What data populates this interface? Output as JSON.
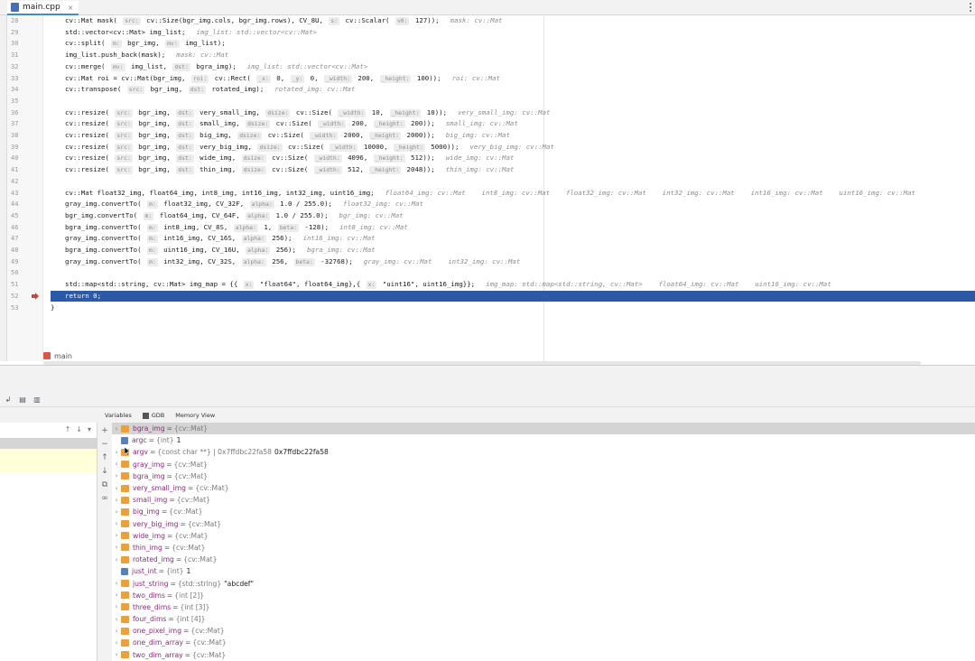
{
  "tab": {
    "file": "main.cpp",
    "close": "×"
  },
  "editor": {
    "lines": [
      {
        "n": "28",
        "parts": [
          [
            "t",
            "cv::Mat mask( "
          ],
          [
            "h",
            "src:"
          ],
          [
            "t",
            " cv::Size(bgr_img.cols, bgr_img.rows), CV_8U, "
          ],
          [
            "h",
            "s:"
          ],
          [
            "t",
            " cv::Scalar( "
          ],
          [
            "h",
            "v0:"
          ],
          [
            "t",
            " 127));"
          ],
          [
            "i",
            "mask: cv::Mat"
          ]
        ]
      },
      {
        "n": "29",
        "parts": [
          [
            "t",
            "std::vector<cv::Mat> img_list;"
          ],
          [
            "i",
            "img_list: std::vector<cv::Mat>"
          ]
        ]
      },
      {
        "n": "30",
        "parts": [
          [
            "t",
            "cv::split( "
          ],
          [
            "h",
            "m:"
          ],
          [
            "t",
            " bgr_img, "
          ],
          [
            "h",
            "mv:"
          ],
          [
            "t",
            " img_list);"
          ]
        ]
      },
      {
        "n": "31",
        "parts": [
          [
            "t",
            "img_list.push_back(mask);"
          ],
          [
            "i",
            "mask: cv::Mat"
          ]
        ]
      },
      {
        "n": "32",
        "parts": [
          [
            "t",
            "cv::merge( "
          ],
          [
            "h",
            "mv:"
          ],
          [
            "t",
            " img_list, "
          ],
          [
            "h",
            "dst:"
          ],
          [
            "t",
            " bgra_img);"
          ],
          [
            "i",
            "img_list: std::vector<cv::Mat>"
          ]
        ]
      },
      {
        "n": "33",
        "parts": [
          [
            "t",
            "cv::Mat roi = cv::Mat(bgr_img, "
          ],
          [
            "h",
            "roi:"
          ],
          [
            "t",
            " cv::Rect( "
          ],
          [
            "h",
            "_x:"
          ],
          [
            "t",
            " 0, "
          ],
          [
            "h",
            "_y:"
          ],
          [
            "t",
            " 0, "
          ],
          [
            "h",
            "_width:"
          ],
          [
            "t",
            " 200, "
          ],
          [
            "h",
            "_height:"
          ],
          [
            "t",
            " 100));"
          ],
          [
            "i",
            "roi: cv::Mat"
          ]
        ]
      },
      {
        "n": "34",
        "parts": [
          [
            "t",
            "cv::transpose( "
          ],
          [
            "h",
            "src:"
          ],
          [
            "t",
            " bgr_img, "
          ],
          [
            "h",
            "dst:"
          ],
          [
            "t",
            " rotated_img);"
          ],
          [
            "i",
            "rotated_img: cv::Mat"
          ]
        ]
      },
      {
        "n": "35",
        "parts": []
      },
      {
        "n": "36",
        "parts": [
          [
            "t",
            "cv::resize( "
          ],
          [
            "h",
            "src:"
          ],
          [
            "t",
            " bgr_img, "
          ],
          [
            "h",
            "dst:"
          ],
          [
            "t",
            " very_small_img, "
          ],
          [
            "h",
            "dsize:"
          ],
          [
            "t",
            " cv::Size( "
          ],
          [
            "h",
            "_width:"
          ],
          [
            "t",
            " 10, "
          ],
          [
            "h",
            "_height:"
          ],
          [
            "t",
            " 10));"
          ],
          [
            "i",
            "very_small_img: cv::Mat"
          ]
        ]
      },
      {
        "n": "37",
        "parts": [
          [
            "t",
            "cv::resize( "
          ],
          [
            "h",
            "src:"
          ],
          [
            "t",
            " bgr_img, "
          ],
          [
            "h",
            "dst:"
          ],
          [
            "t",
            " small_img, "
          ],
          [
            "h",
            "dsize:"
          ],
          [
            "t",
            " cv::Size( "
          ],
          [
            "h",
            "_width:"
          ],
          [
            "t",
            " 200, "
          ],
          [
            "h",
            "_height:"
          ],
          [
            "t",
            " 200));"
          ],
          [
            "i",
            "small_img: cv::Mat"
          ]
        ]
      },
      {
        "n": "38",
        "parts": [
          [
            "t",
            "cv::resize( "
          ],
          [
            "h",
            "src:"
          ],
          [
            "t",
            " bgr_img, "
          ],
          [
            "h",
            "dst:"
          ],
          [
            "t",
            " big_img, "
          ],
          [
            "h",
            "dsize:"
          ],
          [
            "t",
            " cv::Size( "
          ],
          [
            "h",
            "_width:"
          ],
          [
            "t",
            " 2000, "
          ],
          [
            "h",
            "_height:"
          ],
          [
            "t",
            " 2000));"
          ],
          [
            "i",
            "big_img: cv::Mat"
          ]
        ]
      },
      {
        "n": "39",
        "parts": [
          [
            "t",
            "cv::resize( "
          ],
          [
            "h",
            "src:"
          ],
          [
            "t",
            " bgr_img, "
          ],
          [
            "h",
            "dst:"
          ],
          [
            "t",
            " very_big_img, "
          ],
          [
            "h",
            "dsize:"
          ],
          [
            "t",
            " cv::Size( "
          ],
          [
            "h",
            "_width:"
          ],
          [
            "t",
            " 10000, "
          ],
          [
            "h",
            "_height:"
          ],
          [
            "t",
            " 5000));"
          ],
          [
            "i",
            "very_big_img: cv::Mat"
          ]
        ]
      },
      {
        "n": "40",
        "parts": [
          [
            "t",
            "cv::resize( "
          ],
          [
            "h",
            "src:"
          ],
          [
            "t",
            " bgr_img, "
          ],
          [
            "h",
            "dst:"
          ],
          [
            "t",
            " wide_img, "
          ],
          [
            "h",
            "dsize:"
          ],
          [
            "t",
            " cv::Size( "
          ],
          [
            "h",
            "_width:"
          ],
          [
            "t",
            " 4096, "
          ],
          [
            "h",
            "_height:"
          ],
          [
            "t",
            " 512));"
          ],
          [
            "i",
            "wide_img: cv::Mat"
          ]
        ]
      },
      {
        "n": "41",
        "parts": [
          [
            "t",
            "cv::resize( "
          ],
          [
            "h",
            "src:"
          ],
          [
            "t",
            " bgr_img, "
          ],
          [
            "h",
            "dst:"
          ],
          [
            "t",
            " thin_img, "
          ],
          [
            "h",
            "dsize:"
          ],
          [
            "t",
            " cv::Size( "
          ],
          [
            "h",
            "_width:"
          ],
          [
            "t",
            " 512, "
          ],
          [
            "h",
            "_height:"
          ],
          [
            "t",
            " 2048));"
          ],
          [
            "i",
            "thin_img: cv::Mat"
          ]
        ]
      },
      {
        "n": "42",
        "parts": []
      },
      {
        "n": "43",
        "parts": [
          [
            "t",
            "cv::Mat float32_img, float64_img, int8_img, int16_img, int32_img, uint16_img;"
          ],
          [
            "i",
            "float64_img: cv::Mat    int8_img: cv::Mat    float32_img: cv::Mat    int32_img: cv::Mat    int16_img: cv::Mat    uint16_img: cv::Mat"
          ]
        ]
      },
      {
        "n": "44",
        "parts": [
          [
            "t",
            "gray_img.convertTo( "
          ],
          [
            "h",
            "m:"
          ],
          [
            "t",
            " float32_img, CV_32F, "
          ],
          [
            "h",
            "alpha:"
          ],
          [
            "t",
            " 1.0 / 255.0);"
          ],
          [
            "i",
            "float32_img: cv::Mat"
          ]
        ]
      },
      {
        "n": "45",
        "parts": [
          [
            "t",
            "bgr_img.convertTo( "
          ],
          [
            "h",
            "m:"
          ],
          [
            "t",
            " float64_img, CV_64F, "
          ],
          [
            "h",
            "alpha:"
          ],
          [
            "t",
            " 1.0 / 255.0);"
          ],
          [
            "i",
            "bgr_img: cv::Mat"
          ]
        ]
      },
      {
        "n": "46",
        "parts": [
          [
            "t",
            "bgra_img.convertTo( "
          ],
          [
            "h",
            "m:"
          ],
          [
            "t",
            " int8_img, CV_8S, "
          ],
          [
            "h",
            "alpha:"
          ],
          [
            "t",
            " 1, "
          ],
          [
            "h",
            "beta:"
          ],
          [
            "t",
            " -128);"
          ],
          [
            "i",
            "int8_img: cv::Mat"
          ]
        ]
      },
      {
        "n": "47",
        "parts": [
          [
            "t",
            "gray_img.convertTo( "
          ],
          [
            "h",
            "m:"
          ],
          [
            "t",
            " int16_img, CV_16S, "
          ],
          [
            "h",
            "alpha:"
          ],
          [
            "t",
            " 256);"
          ],
          [
            "i",
            "int16_img: cv::Mat"
          ]
        ]
      },
      {
        "n": "48",
        "parts": [
          [
            "t",
            "bgra_img.convertTo( "
          ],
          [
            "h",
            "m:"
          ],
          [
            "t",
            " uint16_img, CV_16U, "
          ],
          [
            "h",
            "alpha:"
          ],
          [
            "t",
            " 256);"
          ],
          [
            "i",
            "bgra_img: cv::Mat"
          ]
        ]
      },
      {
        "n": "49",
        "parts": [
          [
            "t",
            "gray_img.convertTo( "
          ],
          [
            "h",
            "m:"
          ],
          [
            "t",
            " int32_img, CV_32S, "
          ],
          [
            "h",
            "alpha:"
          ],
          [
            "t",
            " 256, "
          ],
          [
            "h",
            "beta:"
          ],
          [
            "t",
            " -32768);"
          ],
          [
            "i",
            "gray_img: cv::Mat    int32_img: cv::Mat"
          ]
        ]
      },
      {
        "n": "50",
        "parts": []
      },
      {
        "n": "51",
        "parts": [
          [
            "t",
            "std::map<std::string, cv::Mat> img_map = {{ "
          ],
          [
            "h",
            "x:"
          ],
          [
            "t",
            " \"float64\", float64_img},{ "
          ],
          [
            "h",
            "x:"
          ],
          [
            "t",
            " \"uint16\", uint16_img}};"
          ],
          [
            "i",
            "img_map: std::map<std::string, cv::Mat>    float64_img: cv::Mat    uint16_img: cv::Mat"
          ]
        ]
      },
      {
        "n": "52",
        "parts": [
          [
            "t",
            "return 0;"
          ]
        ],
        "exec": true
      },
      {
        "n": "53",
        "parts": [
          [
            "t",
            "}"
          ]
        ],
        "brace": true
      }
    ]
  },
  "breadcrumb": {
    "label": "main"
  },
  "debug": {
    "tabs": [
      "Variables",
      "GDB",
      "Memory View"
    ],
    "frame_tools": [
      "↑",
      "↓",
      "▾"
    ],
    "side_buttons": [
      "+",
      "−",
      "↑",
      "↓",
      "⧉",
      "∞"
    ],
    "variables": [
      {
        "expand": true,
        "icon": "struct",
        "name": "bgra_img",
        "type": "{cv::Mat}",
        "value": "",
        "selected": true
      },
      {
        "expand": false,
        "icon": "prim",
        "name": "argc",
        "type": "{int}",
        "value": "1"
      },
      {
        "expand": true,
        "icon": "struct",
        "name": "argv",
        "type": "{const char **} 0x7ffdbc22fa58",
        "value": "0x7ffdbc22fa58"
      },
      {
        "expand": true,
        "icon": "struct",
        "name": "gray_img",
        "type": "{cv::Mat}",
        "value": ""
      },
      {
        "expand": true,
        "icon": "struct",
        "name": "bgra_img",
        "type": "{cv::Mat}",
        "value": ""
      },
      {
        "expand": true,
        "icon": "struct",
        "name": "very_small_img",
        "type": "{cv::Mat}",
        "value": ""
      },
      {
        "expand": true,
        "icon": "struct",
        "name": "small_img",
        "type": "{cv::Mat}",
        "value": ""
      },
      {
        "expand": true,
        "icon": "struct",
        "name": "big_img",
        "type": "{cv::Mat}",
        "value": ""
      },
      {
        "expand": true,
        "icon": "struct",
        "name": "very_big_img",
        "type": "{cv::Mat}",
        "value": ""
      },
      {
        "expand": true,
        "icon": "struct",
        "name": "wide_img",
        "type": "{cv::Mat}",
        "value": ""
      },
      {
        "expand": true,
        "icon": "struct",
        "name": "thin_img",
        "type": "{cv::Mat}",
        "value": ""
      },
      {
        "expand": true,
        "icon": "struct",
        "name": "rotated_img",
        "type": "{cv::Mat}",
        "value": ""
      },
      {
        "expand": false,
        "icon": "prim",
        "name": "just_int",
        "type": "{int}",
        "value": "1"
      },
      {
        "expand": true,
        "icon": "struct",
        "name": "just_string",
        "type": "{std::string}",
        "value": "\"abcdef\""
      },
      {
        "expand": true,
        "icon": "struct",
        "name": "two_dims",
        "type": "{int [2]}",
        "value": ""
      },
      {
        "expand": true,
        "icon": "struct",
        "name": "three_dims",
        "type": "{int [3]}",
        "value": ""
      },
      {
        "expand": true,
        "icon": "struct",
        "name": "four_dims",
        "type": "{int [4]}",
        "value": ""
      },
      {
        "expand": true,
        "icon": "struct",
        "name": "one_pixel_img",
        "type": "{cv::Mat}",
        "value": ""
      },
      {
        "expand": true,
        "icon": "struct",
        "name": "one_dim_array",
        "type": "{cv::Mat}",
        "value": ""
      },
      {
        "expand": true,
        "icon": "struct",
        "name": "two_dim_array",
        "type": "{cv::Mat}",
        "value": ""
      }
    ]
  }
}
